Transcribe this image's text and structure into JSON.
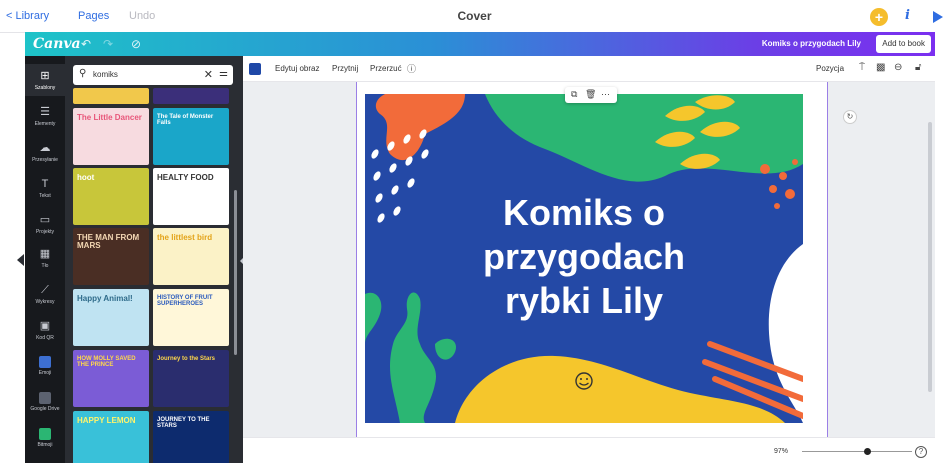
{
  "topbar": {
    "library_label": "< Library",
    "pages_label": "Pages",
    "undo_label": "Undo",
    "cover_title": "Cover",
    "plus_label": "+",
    "info_label": "i"
  },
  "canva": {
    "logo": "Canva",
    "doc_title": "Komiks o przygodach Lily",
    "add_to_book": "Add to book"
  },
  "rail": [
    {
      "icon": "templates-icon",
      "glyph": "⊞",
      "label": "Szablony"
    },
    {
      "icon": "elements-icon",
      "glyph": "☰",
      "label": "Elementy"
    },
    {
      "icon": "uploads-icon",
      "glyph": "☁",
      "label": "Przesyłanie"
    },
    {
      "icon": "text-icon",
      "glyph": "T",
      "label": "Tekst"
    },
    {
      "icon": "projects-icon",
      "glyph": "▭",
      "label": "Projekty"
    },
    {
      "icon": "background-icon",
      "glyph": "▦",
      "label": "Tło"
    },
    {
      "icon": "charts-icon",
      "glyph": "⟋",
      "label": "Wykresy"
    },
    {
      "icon": "qr-code-icon",
      "glyph": "▣",
      "label": "Kod QR"
    },
    {
      "icon": "emoji-app-icon",
      "glyph": "",
      "label": "Emoji"
    },
    {
      "icon": "google-drive-icon",
      "glyph": "",
      "label": "Google Drive"
    },
    {
      "icon": "bitmoji-icon",
      "glyph": "",
      "label": "Bitmoji"
    }
  ],
  "search": {
    "value": "komiks",
    "icon": "search-icon"
  },
  "thumbnails": [
    {
      "title": "The Little Dancer",
      "subtitle": "",
      "bg": "#f7dbe0",
      "color": "#e8567a"
    },
    {
      "title": "The Tale of Monster Falls",
      "subtitle": "",
      "bg": "#1aa6c9",
      "color": "#ffffff"
    },
    {
      "title": "hoot",
      "subtitle": "",
      "bg": "#c8c63a",
      "color": "#ffffff"
    },
    {
      "title": "HEALTY FOOD",
      "subtitle": "",
      "bg": "#ffffff",
      "color": "#333333"
    },
    {
      "title": "THE MAN FROM MARS",
      "subtitle": "",
      "bg": "#4a2e24",
      "color": "#f3d7b3"
    },
    {
      "title": "the littlest bird",
      "subtitle": "",
      "bg": "#fbf2c7",
      "color": "#e3a319"
    },
    {
      "title": "Happy Animal!",
      "subtitle": "",
      "bg": "#bfe3f2",
      "color": "#2e6b8a"
    },
    {
      "title": "HISTORY OF FRUIT SUPERHEROES",
      "subtitle": "",
      "bg": "#fff7d9",
      "color": "#2b5bbd"
    },
    {
      "title": "HOW MOLLY SAVED THE PRINCE",
      "subtitle": "",
      "bg": "#7b5cd6",
      "color": "#ffd84a"
    },
    {
      "title": "Journey to the Stars",
      "subtitle": "",
      "bg": "#2a2d6e",
      "color": "#ffd84a"
    },
    {
      "title": "HAPPY LEMON",
      "subtitle": "",
      "bg": "#39c1d9",
      "color": "#fff36b"
    },
    {
      "title": "JOURNEY TO THE STARS",
      "subtitle": "",
      "bg": "#0d2b6e",
      "color": "#ffffff"
    }
  ],
  "toolbar": {
    "edit_image": "Edytuj obraz",
    "crop": "Przytnij",
    "flip": "Przerzuć",
    "position": "Pozycja",
    "swatch_color": "#1f48a7"
  },
  "design": {
    "title_line1": "Komiks o",
    "title_line2": "przygodach",
    "title_line3": "rybki Lily",
    "bg_color": "#2449a6"
  },
  "bottom": {
    "zoom": "97%",
    "zoom_fraction": 0.6
  }
}
